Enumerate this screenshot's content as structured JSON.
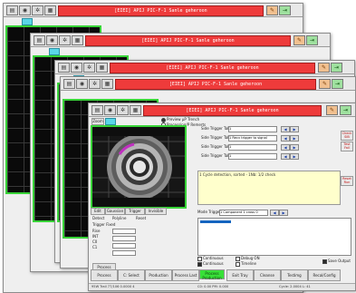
{
  "app": {
    "title": "[EIEI] APIJ PIC-F-1 Sanle geheroon"
  },
  "toolbar": {
    "wrench_icon": "wrench-icon",
    "exit_icon": "exit-icon"
  },
  "options": {
    "preview": "Preview µP Trench",
    "processing": "Processing/P Remerts",
    "zoom": "Zoom"
  },
  "trigger_rows": [
    {
      "label": "Side Trigger Tab 1",
      "value": "1"
    },
    {
      "label": "Side Trigger Tab 2",
      "value": "1 Recv trigger to signal"
    },
    {
      "label": "Side Trigger Tab 3",
      "value": "1"
    },
    {
      "label": "Side Trigger Tab 4",
      "value": "1"
    }
  ],
  "left_panel": {
    "trigger_fixed": "Trigger Fixed",
    "rows": [
      "Rise",
      "INT",
      "C0",
      "C1"
    ],
    "buttons": [
      "Process",
      "Run"
    ],
    "toolbar_labels": [
      "Edit",
      "Gaussian",
      "Trigger",
      "Invisible"
    ],
    "detector_labels": [
      "Detect",
      "Polyline",
      "Reset"
    ]
  },
  "yellow_panel": {
    "text": "1   Cycle detection, sorted  -   1Nb: 1/2  check"
  },
  "mode_row": {
    "label": "Mode Trigger",
    "value": "1 Component  1 cross  0"
  },
  "checkboxes": [
    {
      "label": "Continuous",
      "checked": false
    },
    {
      "label": "Debug ON",
      "checked": false
    },
    {
      "label": "Continuous",
      "checked": true
    },
    {
      "label": "Timeline",
      "checked": false
    },
    {
      "label": "Save Output",
      "checked": true
    }
  ],
  "bottom_tabs": [
    {
      "label": "Process",
      "active": false
    },
    {
      "label": "C: Select",
      "active": false
    },
    {
      "label": "Production",
      "active": false
    },
    {
      "label": "Process Last",
      "active": false
    },
    {
      "label": "Process Production",
      "active": true
    },
    {
      "label": "Exit Tray",
      "active": false
    },
    {
      "label": "Cleanse",
      "active": false
    },
    {
      "label": "Testimg",
      "active": false
    },
    {
      "label": "Recal/Config",
      "active": false
    }
  ],
  "right_column": [
    "Check SIB",
    "Test Fail",
    "Reset Run"
  ],
  "status": {
    "left": "95W Trail 77/106 0.0000  4",
    "mid": "C0:  0.00 PM:  0.000",
    "right": "Cycle: 2.0004 L: 41"
  },
  "colors": {
    "title_red": "#ee3b3b",
    "image_border": "#38d438",
    "active_tab": "#38e038",
    "status_blue": "#1565c0"
  }
}
